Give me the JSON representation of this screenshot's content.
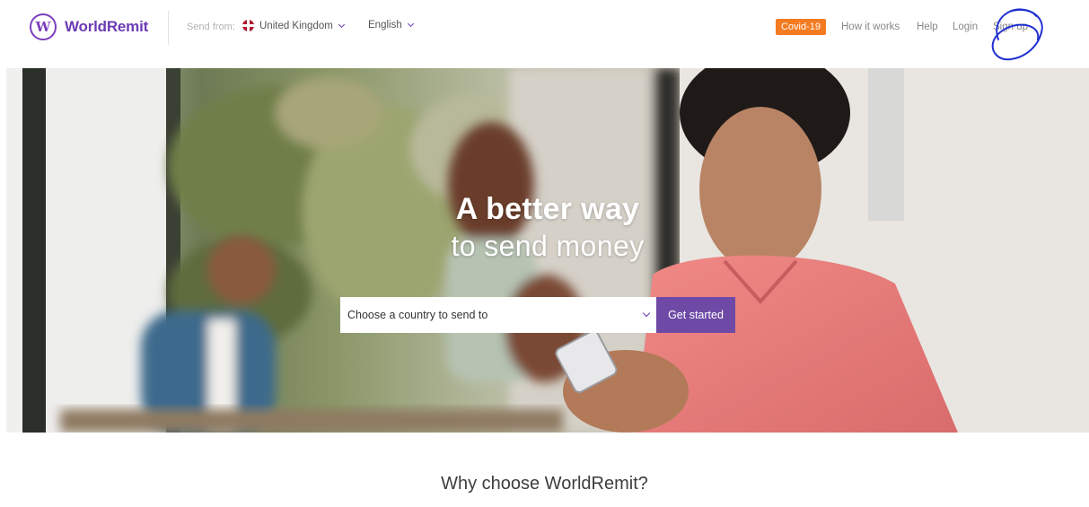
{
  "header": {
    "brand": "WorldRemit",
    "logo_letter": "W",
    "send_from_label": "Send from:",
    "country": "United Kingdom",
    "language": "English",
    "covid_label": "Covid-19",
    "nav": {
      "how_it_works": "How it works",
      "help": "Help",
      "login": "Login",
      "signup": "Sign up"
    }
  },
  "hero": {
    "title_line1": "A better way",
    "title_line2": "to send money",
    "country_select_placeholder": "Choose a country to send to",
    "cta_label": "Get started"
  },
  "why": {
    "heading": "Why choose WorldRemit?"
  },
  "colors": {
    "brand_purple": "#6c3bb5",
    "cta_purple": "#6e4aa6",
    "covid_orange": "#f47b20",
    "scribble_blue": "#1f2fd1"
  },
  "icons": [
    "worldremit-logo-icon",
    "uk-flag-icon",
    "chevron-down-icon"
  ]
}
